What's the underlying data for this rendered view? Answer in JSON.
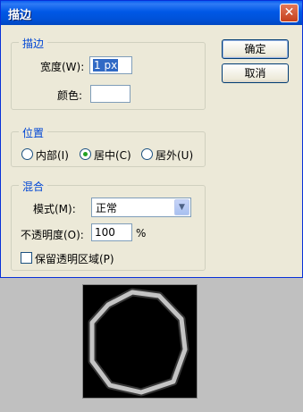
{
  "window": {
    "title": "描边",
    "close_glyph": "✕"
  },
  "stroke_group": {
    "title": "描边",
    "width_label": "宽度(W):",
    "width_value": "1 px",
    "color_label": "颜色:",
    "color_value": "#ffffff"
  },
  "position_group": {
    "title": "位置",
    "options": [
      {
        "label": "内部(I)",
        "selected": false
      },
      {
        "label": "居中(C)",
        "selected": true
      },
      {
        "label": "居外(U)",
        "selected": false
      }
    ]
  },
  "blend_group": {
    "title": "混合",
    "mode_label": "模式(M):",
    "mode_value": "正常",
    "opacity_label": "不透明度(O):",
    "opacity_value": "100",
    "opacity_unit": "%",
    "preserve_label": "保留透明区域(P)",
    "preserve_checked": false
  },
  "buttons": {
    "ok": "确定",
    "cancel": "取消"
  },
  "colors": {
    "accent": "#0046d5",
    "titlebar": "#0058e6",
    "canvas": "#c0c0c0"
  }
}
